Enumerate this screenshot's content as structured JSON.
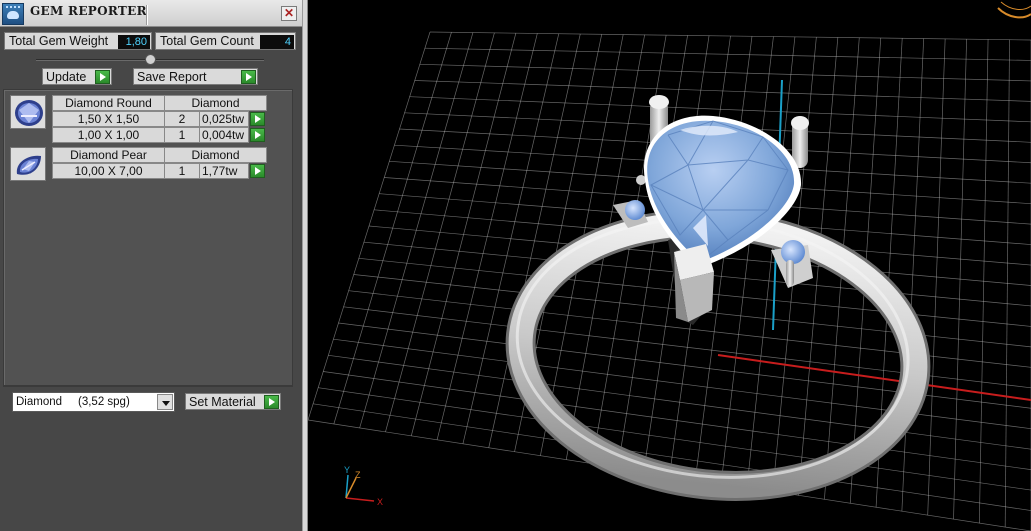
{
  "panel": {
    "title": "GEM REPORTER",
    "close_glyph": "✕",
    "total_weight_label": "Total Gem Weight",
    "total_weight_value": "1,80",
    "total_count_label": "Total Gem Count",
    "total_count_value": "4",
    "update_label": "Update",
    "save_report_label": "Save Report"
  },
  "gems": [
    {
      "shape": "Diamond Round",
      "material": "Diamond",
      "icon": "round-gem-icon",
      "rows": [
        {
          "size": "1,50 X 1,50",
          "count": "2",
          "weight": "0,025tw"
        },
        {
          "size": "1,00 X 1,00",
          "count": "1",
          "weight": "0,004tw"
        }
      ]
    },
    {
      "shape": "Diamond Pear",
      "material": "Diamond",
      "icon": "pear-gem-icon",
      "rows": [
        {
          "size": "10,00 X 7,00",
          "count": "1",
          "weight": "1,77tw"
        }
      ]
    }
  ],
  "material_select": {
    "value": "Diamond     (3,52 spg)"
  },
  "set_material_label": "Set Material",
  "viewport": {
    "axis_labels": {
      "x": "X",
      "y": "Y",
      "z": "Z"
    },
    "colors": {
      "gem": "#7fa6d9",
      "metal": "#d9d9d9",
      "grid": "#bdbdbd",
      "x_axis": "#c81d1d",
      "y_axis": "#1aa0c8",
      "accent": "#d88b2a"
    }
  }
}
